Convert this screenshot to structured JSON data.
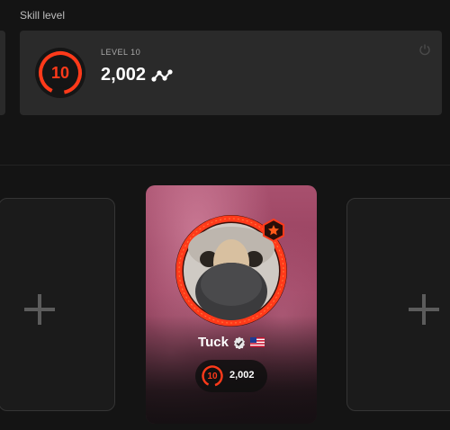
{
  "section": {
    "title": "Skill level"
  },
  "skill": {
    "level_label": "LEVEL 10",
    "level_number": "10",
    "elo": "2,002",
    "accent_color": "#ff3a1a"
  },
  "icons": {
    "elo_trend": "elo-graph-icon",
    "power": "power-icon",
    "plus": "plus-icon",
    "verified": "verified-check-icon",
    "flag": "us-flag-icon",
    "badge": "star-badge-icon"
  },
  "player_card": {
    "name": "Tuck",
    "level_number": "10",
    "elo": "2,002"
  }
}
